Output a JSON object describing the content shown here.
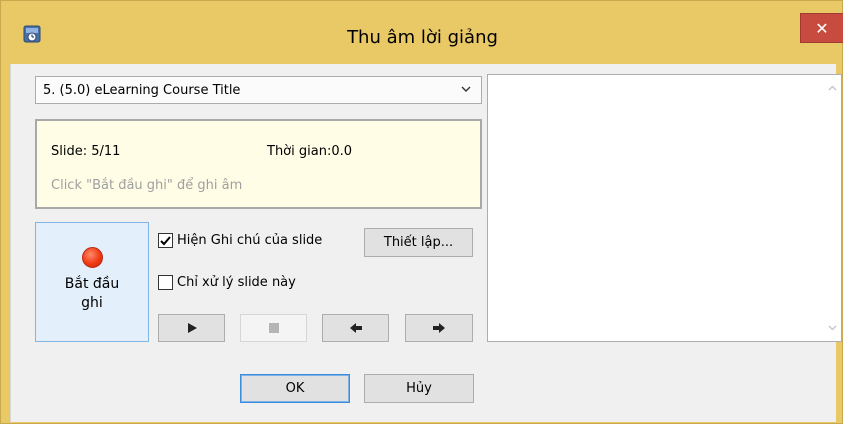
{
  "window": {
    "title": "Thu âm lời giảng",
    "close_label": "✕"
  },
  "slide_select": {
    "selected": "5. (5.0) eLearning Course Title"
  },
  "info": {
    "slide_label": "Slide: 5/11",
    "time_label": "Thời gian:0.0",
    "hint": "Click \"Bắt đầu ghi\" để ghi âm"
  },
  "record": {
    "label": "Bắt đầu\nghi"
  },
  "options": {
    "show_notes_label": "Hiện Ghi chú của slide",
    "show_notes_checked": true,
    "this_slide_only_label": "Chỉ xử lý slide này",
    "this_slide_only_checked": false,
    "settings_label": "Thiết lập..."
  },
  "transport": {
    "play_icon": "play-icon",
    "stop_icon": "stop-icon",
    "prev_icon": "arrow-left-icon",
    "next_icon": "arrow-right-icon"
  },
  "footer": {
    "ok_label": "OK",
    "cancel_label": "Hủy"
  },
  "notes": {
    "content": ""
  },
  "colors": {
    "title_bar": "#e9c866",
    "close_button": "#c74b3f",
    "info_panel": "#fffde6",
    "record_button": "#e3effb",
    "record_dot": "#f03a12"
  }
}
